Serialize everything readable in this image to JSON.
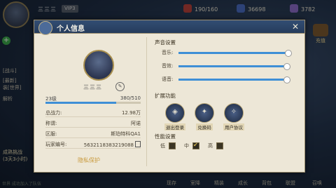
{
  "topbar": {
    "player_name": "三三三",
    "vip_label": "VIP3",
    "stamina": "190/160",
    "currency_1": "36698",
    "currency_2": "3782"
  },
  "side_left": {
    "line1": "[战斗]",
    "line2": "[最新]",
    "line3": "装[世界]",
    "line4": "解析",
    "event_title": "成熟挑战",
    "event_sub": "(3天3小时)",
    "chat_preview": "世界 成功加入了队伍"
  },
  "recharge_label": "充值",
  "bottom_nav": [
    "现存",
    "室降",
    "精装",
    "成长",
    "背包",
    "联盟",
    "召唤"
  ],
  "panel": {
    "title": "个人信息",
    "profile": {
      "name": "三三三",
      "level": "23级",
      "exp": "380/510",
      "exp_fraction": 0.745
    },
    "stats": [
      {
        "key": "总战力:",
        "value": "12.98万"
      },
      {
        "key": "称谓:",
        "value": "阿诺"
      },
      {
        "key": "区服:",
        "value": "斯珀特科QA1"
      },
      {
        "key": "玩家编号:",
        "value": "5632118383219088"
      }
    ],
    "privacy_label": "隐私保护",
    "sound": {
      "title": "声音设置",
      "sliders": [
        {
          "label": "音乐:",
          "level": 1.0
        },
        {
          "label": "音效:",
          "level": 0.98
        },
        {
          "label": "语音:",
          "level": 0.98
        }
      ]
    },
    "extended": {
      "title": "扩展功能",
      "items": [
        {
          "label": "退出登录",
          "icon": "logout-icon"
        },
        {
          "label": "兑换码",
          "icon": "gift-icon"
        },
        {
          "label": "用户协议",
          "icon": "agreement-icon"
        }
      ]
    },
    "performance": {
      "title": "性能设置",
      "options": [
        {
          "label": "低",
          "checked": false
        },
        {
          "label": "中",
          "checked": true
        },
        {
          "label": "高",
          "checked": false
        }
      ]
    }
  }
}
